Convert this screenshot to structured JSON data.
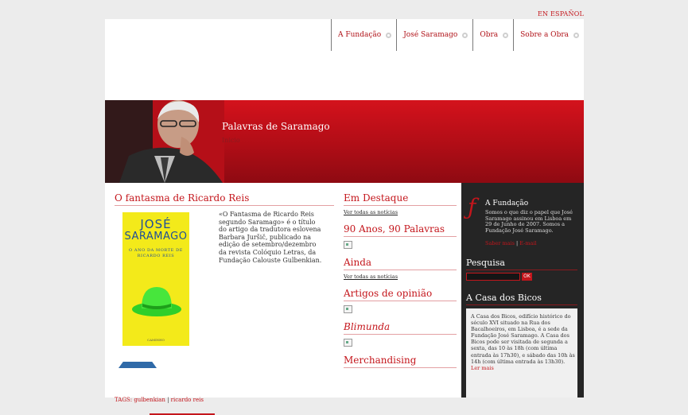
{
  "lang_link": "EN ESPAÑOL",
  "nav": [
    {
      "label": "A Fundação"
    },
    {
      "label": "José Saramago"
    },
    {
      "label": "Obra"
    },
    {
      "label": "Sobre a Obra"
    }
  ],
  "banner": {
    "title": "Palavras de Saramago",
    "subtitle": "Inicio"
  },
  "article": {
    "title": "O fantasma de Ricardo Reis",
    "book": {
      "author_line1": "JOSÉ",
      "author_line2": "SARAMAGO",
      "subtitle": "O ANO DA MORTE DE RICARDO REIS",
      "publisher": "CAMINHO"
    },
    "text": "«O Fantasma de Ricardo Reis segundo Saramago» é o título do artigo da tradutora eslovena Barbara Juršič, publicado na edição de setembro/dezembro da revista Colóquio Letras, da Fundação Calouste Gulbenkian.",
    "tags_label": "TAGS:",
    "tags": [
      "gulbenkian",
      "ricardo reis"
    ]
  },
  "middle": {
    "destaque_title": "Em Destaque",
    "destaque_link": "Ver todas as notícias",
    "anos_title": "90 Anos, 90 Palavras",
    "ainda_title": "Ainda",
    "ainda_link": "Ver todas as notícias",
    "opiniao_title": "Artigos de opinião",
    "blimunda_title": "Blimunda",
    "merch_title": "Merchandising"
  },
  "sidebar": {
    "fundacao_title": "A Fundação",
    "fundacao_text": "Somos o que diz o papel que José Saramago assinou em Lisboa em 29 de Junho de 2007. Somos a Fundação José Saramago.",
    "saber_mais": "Saber mais",
    "email": "E-mail",
    "pesquisa_title": "Pesquisa",
    "search_button": "OK",
    "casa_title": "A Casa dos Bicos",
    "casa_text": "A Casa dos Bicos, edifício histórico do século XVI situado na Rua dos Bacalhoeiros, em Lisboa, é a sede da Fundação José Saramago. A Casa dos Bicos pode ser visitada de segunda a sexta, das 10 às 18h (com última entrada às 17h30), e sábado das 10h às 14h (com última entrada às 13h30).",
    "ler_mais": "Ler mais"
  }
}
